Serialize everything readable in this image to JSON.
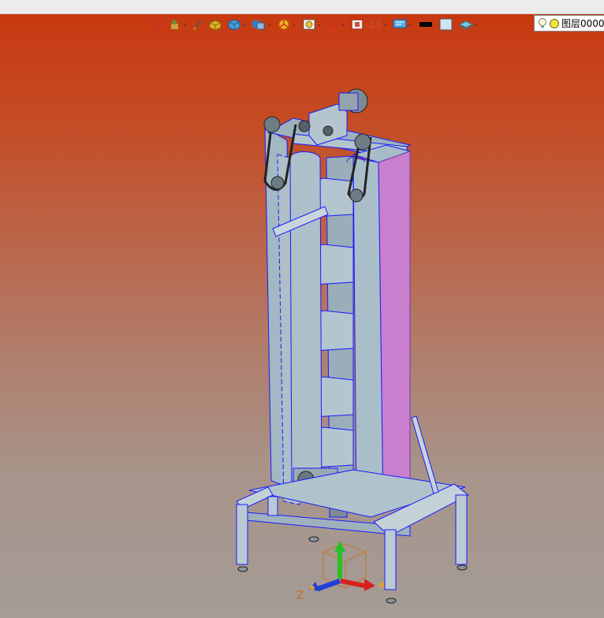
{
  "toolbar": {
    "items": [
      {
        "name": "exit-sketch-icon",
        "dropdown": false
      },
      {
        "name": "part-icon",
        "dropdown": true
      },
      {
        "name": "sketch-pen-icon",
        "dropdown": false
      },
      {
        "name": "box-icon",
        "dropdown": false
      },
      {
        "name": "cube-icon",
        "dropdown": true
      },
      {
        "name": "assembly-icon",
        "dropdown": true
      },
      {
        "name": "pie-icon",
        "dropdown": true
      },
      {
        "name": "zoom-view-icon",
        "dropdown": true
      },
      {
        "name": "origin-icon",
        "dropdown": true
      },
      {
        "name": "section-view-icon",
        "dropdown": false
      },
      {
        "name": "dimension-icon",
        "dropdown": true
      },
      {
        "name": "display-monitor-icon",
        "dropdown": true
      },
      {
        "name": "line-color-swatch-icon",
        "dropdown": false
      },
      {
        "name": "fill-color-swatch-icon",
        "dropdown": false
      },
      {
        "name": "layer-stack-icon",
        "dropdown": true
      }
    ],
    "colors": {
      "line_swatch": "#000000",
      "fill_swatch": "#cfe3f5"
    }
  },
  "layer": {
    "label": "图层0000"
  },
  "triad": {
    "z_label": "Z"
  },
  "colors": {
    "bg_top": "#c9360e",
    "bg_bottom": "#a49c96",
    "model_body": "#a7bcc6",
    "model_highlight": "#cc7fcf",
    "edge": "#1a1aff"
  }
}
